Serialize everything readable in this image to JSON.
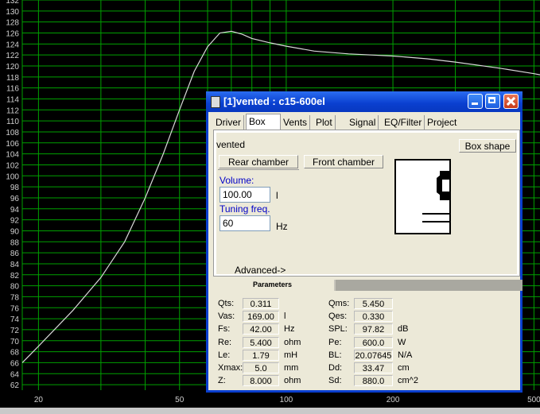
{
  "plot": {
    "background": "#000000",
    "grid_color": "#00a000",
    "curve_color": "#d8d8d8",
    "y_ticks": [
      "132",
      "130",
      "128",
      "126",
      "124",
      "122",
      "120",
      "118",
      "116",
      "114",
      "112",
      "110",
      "108",
      "106",
      "104",
      "102",
      "100",
      "98",
      "96",
      "94",
      "92",
      "90",
      "88",
      "86",
      "84",
      "82",
      "80",
      "78",
      "76",
      "74",
      "72",
      "70",
      "68",
      "66",
      "64",
      "62"
    ],
    "x_tick_labels": [
      "20",
      "50",
      "100",
      "200",
      "500"
    ],
    "y_range": [
      61,
      132
    ],
    "x_range_hz": [
      18,
      520
    ],
    "response_curve": [
      [
        18,
        66
      ],
      [
        20,
        69
      ],
      [
        25,
        75.5
      ],
      [
        30,
        81.5
      ],
      [
        35,
        88
      ],
      [
        40,
        96
      ],
      [
        45,
        104
      ],
      [
        50,
        112
      ],
      [
        55,
        119
      ],
      [
        60,
        123.5
      ],
      [
        65,
        126
      ],
      [
        70,
        126.3
      ],
      [
        75,
        125.8
      ],
      [
        80,
        125
      ],
      [
        90,
        124.2
      ],
      [
        100,
        123.6
      ],
      [
        120,
        122.7
      ],
      [
        150,
        122.2
      ],
      [
        200,
        121.8
      ],
      [
        250,
        121.3
      ],
      [
        300,
        120.7
      ],
      [
        400,
        119.6
      ],
      [
        500,
        118.6
      ],
      [
        520,
        118.4
      ]
    ]
  },
  "window": {
    "title": "[1]vented :  c15-600el",
    "tabs": [
      "Driver",
      "Box",
      "Vents",
      "Plot",
      "Signal",
      "EQ/Filter",
      "Project"
    ],
    "active_tab": "Box",
    "box_type": "vented",
    "box_shape_button": "Box shape",
    "rear_chamber_button": "Rear chamber",
    "front_chamber_button": "Front chamber",
    "volume_label": "Volume:",
    "volume_value": "100.00",
    "volume_unit": "l",
    "tuning_label": "Tuning freq.",
    "tuning_value": "60",
    "tuning_unit": "Hz",
    "advanced_label": "Advanced->",
    "params_tab": "Parameters"
  },
  "params_left": [
    {
      "label": "Qts:",
      "value": "0.311",
      "unit": ""
    },
    {
      "label": "Vas:",
      "value": "169.00",
      "unit": "l"
    },
    {
      "label": "Fs:",
      "value": "42.00",
      "unit": "Hz"
    },
    {
      "label": "Re:",
      "value": "5.400",
      "unit": "ohm"
    },
    {
      "label": "Le:",
      "value": "1.79",
      "unit": "mH"
    },
    {
      "label": "Xmax:",
      "value": "5.0",
      "unit": "mm"
    },
    {
      "label": "Z:",
      "value": "8.000",
      "unit": "ohm"
    }
  ],
  "params_right": [
    {
      "label": "Qms:",
      "value": "5.450",
      "unit": ""
    },
    {
      "label": "Qes:",
      "value": "0.330",
      "unit": ""
    },
    {
      "label": "SPL:",
      "value": "97.82",
      "unit": "dB"
    },
    {
      "label": "Pe:",
      "value": "600.0",
      "unit": "W"
    },
    {
      "label": "BL:",
      "value": "20.07645",
      "unit": "N/A"
    },
    {
      "label": "Dd:",
      "value": "33.47",
      "unit": "cm"
    },
    {
      "label": "Sd:",
      "value": "880.0",
      "unit": "cm^2"
    }
  ]
}
